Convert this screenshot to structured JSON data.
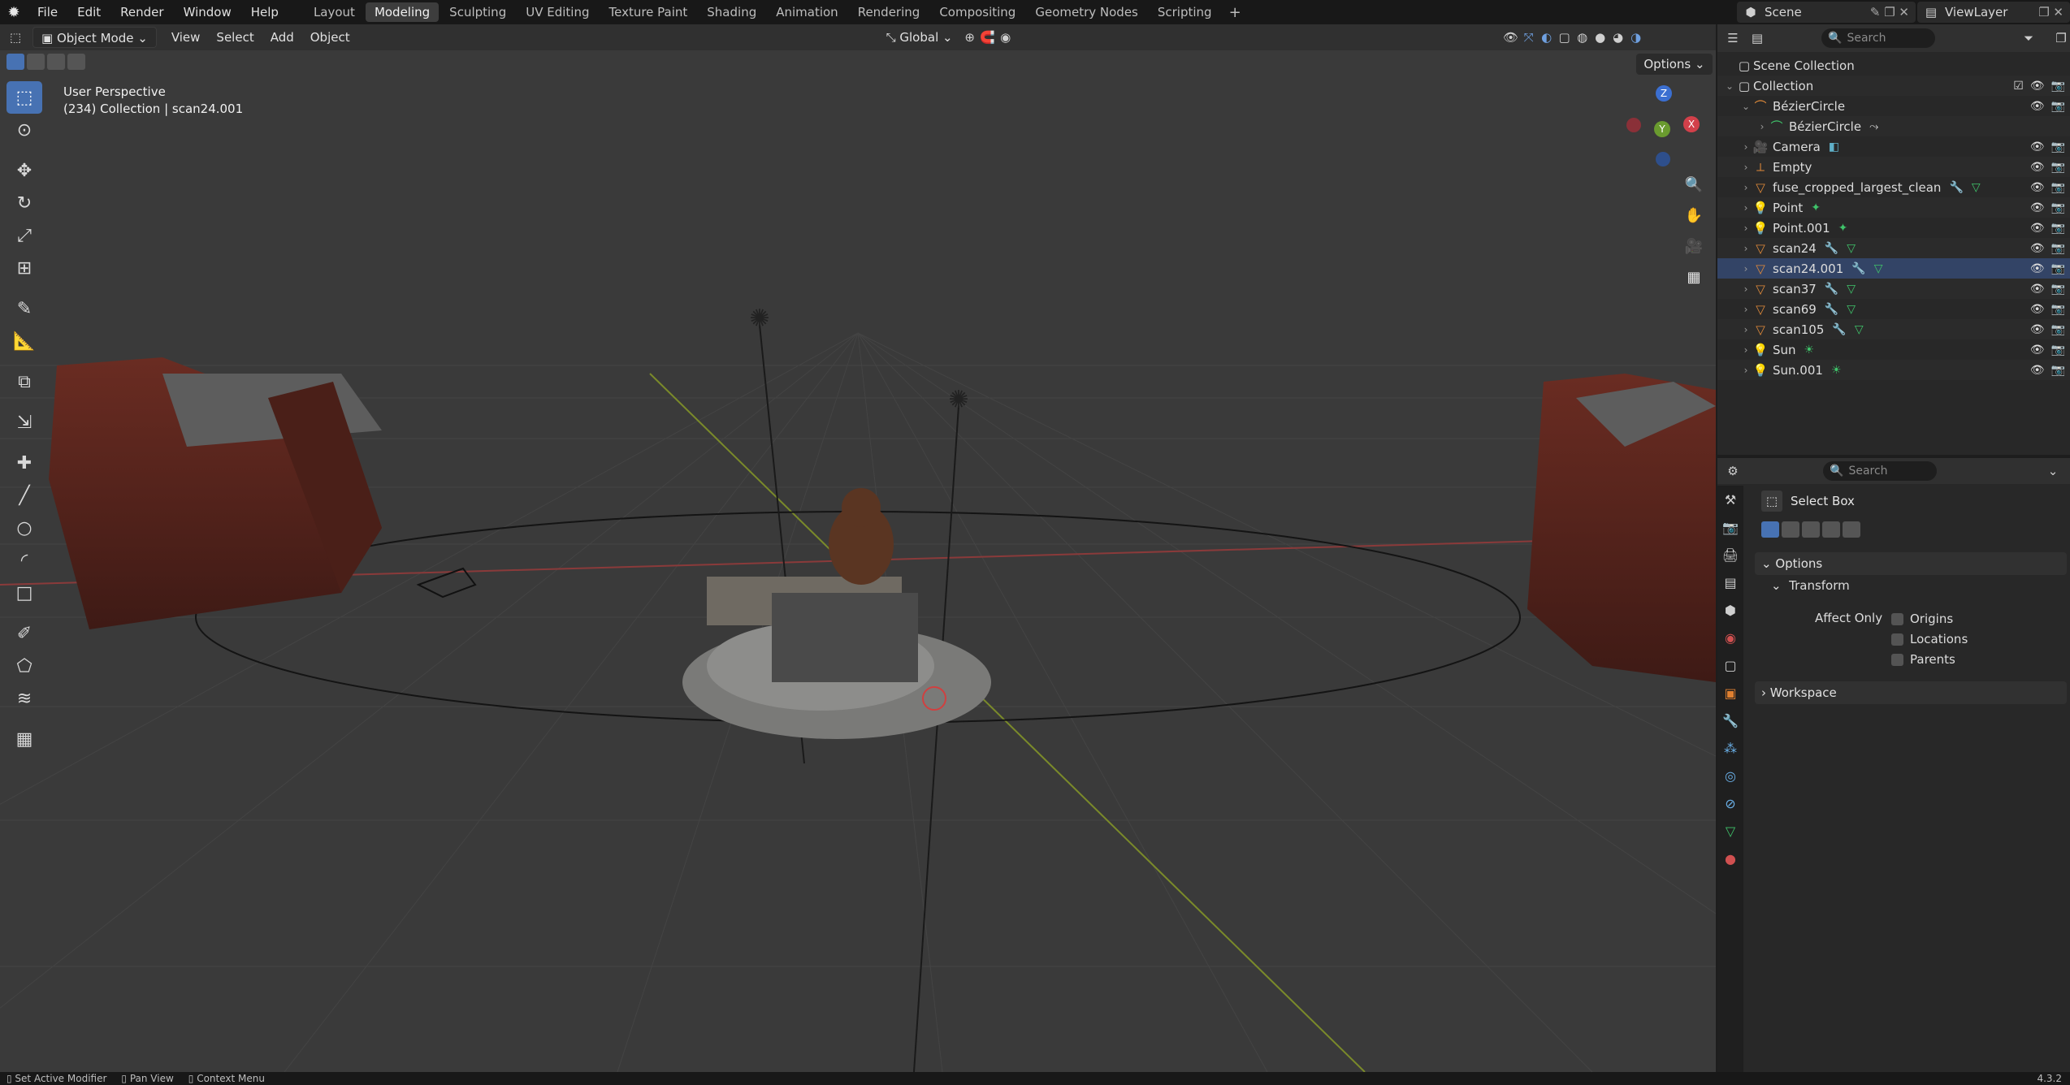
{
  "app": {
    "logo_icon": "blender-logo-icon"
  },
  "menus": [
    "File",
    "Edit",
    "Render",
    "Window",
    "Help"
  ],
  "workspaces": [
    {
      "label": "Layout",
      "active": false
    },
    {
      "label": "Modeling",
      "active": true
    },
    {
      "label": "Sculpting",
      "active": false
    },
    {
      "label": "UV Editing",
      "active": false
    },
    {
      "label": "Texture Paint",
      "active": false
    },
    {
      "label": "Shading",
      "active": false
    },
    {
      "label": "Animation",
      "active": false
    },
    {
      "label": "Rendering",
      "active": false
    },
    {
      "label": "Compositing",
      "active": false
    },
    {
      "label": "Geometry Nodes",
      "active": false
    },
    {
      "label": "Scripting",
      "active": false
    }
  ],
  "scene": {
    "label": "Scene",
    "view_layer": "ViewLayer"
  },
  "viewport": {
    "mode": "Object Mode",
    "menus": [
      "View",
      "Select",
      "Add",
      "Object"
    ],
    "transform_orientation": "Global",
    "options_label": "Options",
    "info_line_1": "User Perspective",
    "info_line_2": "(234) Collection | scan24.001",
    "gizmo": {
      "z": "Z",
      "y": "Y",
      "x": "X"
    },
    "accent": "#4772b3"
  },
  "outliner": {
    "search_placeholder": "Search",
    "scene_collection": "Scene Collection",
    "collection": "Collection",
    "items": [
      {
        "name": "BézierCircle",
        "icon": "curve-icon",
        "indent": 2,
        "expanded": true
      },
      {
        "name": "BézierCircle",
        "icon": "curve-data-icon",
        "indent": 3,
        "expanded": false
      },
      {
        "name": "Camera",
        "icon": "camera-icon",
        "indent": 2,
        "expanded": false
      },
      {
        "name": "Empty",
        "icon": "empty-icon",
        "indent": 2,
        "expanded": false
      },
      {
        "name": "fuse_cropped_largest_clean",
        "icon": "mesh-icon",
        "indent": 2,
        "expanded": false
      },
      {
        "name": "Point",
        "icon": "light-icon",
        "indent": 2,
        "expanded": false
      },
      {
        "name": "Point.001",
        "icon": "light-icon",
        "indent": 2,
        "expanded": false
      },
      {
        "name": "scan24",
        "icon": "mesh-icon",
        "indent": 2,
        "expanded": false
      },
      {
        "name": "scan24.001",
        "icon": "mesh-icon",
        "indent": 2,
        "expanded": false,
        "selected": true
      },
      {
        "name": "scan37",
        "icon": "mesh-icon",
        "indent": 2,
        "expanded": false
      },
      {
        "name": "scan69",
        "icon": "mesh-icon",
        "indent": 2,
        "expanded": false
      },
      {
        "name": "scan105",
        "icon": "mesh-icon",
        "indent": 2,
        "expanded": false
      },
      {
        "name": "Sun",
        "icon": "light-icon",
        "indent": 2,
        "expanded": false
      },
      {
        "name": "Sun.001",
        "icon": "light-icon",
        "indent": 2,
        "expanded": false
      }
    ]
  },
  "properties": {
    "search_placeholder": "Search",
    "tool_name": "Select Box",
    "options_panel": "Options",
    "transform_panel": "Transform",
    "affect_only_label": "Affect Only",
    "checkboxes": [
      "Origins",
      "Locations",
      "Parents"
    ],
    "workspace_panel": "Workspace"
  },
  "statusbar": {
    "items": [
      "Set Active Modifier",
      "Pan View",
      "Context Menu"
    ],
    "version": "4.3.2"
  }
}
